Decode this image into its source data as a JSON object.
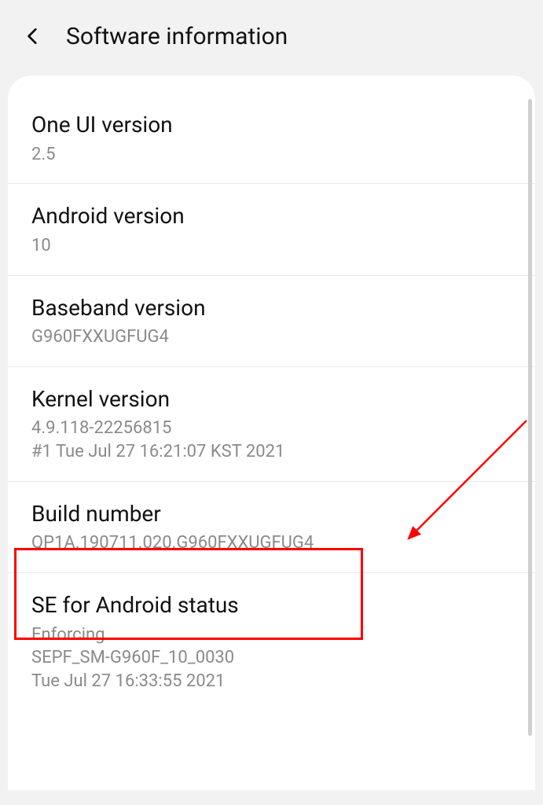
{
  "header": {
    "title": "Software information"
  },
  "items": [
    {
      "title": "One UI version",
      "value": "2.5"
    },
    {
      "title": "Android version",
      "value": "10"
    },
    {
      "title": "Baseband version",
      "value": "G960FXXUGFUG4"
    },
    {
      "title": "Kernel version",
      "value": "4.9.118-22256815\n#1 Tue Jul 27 16:21:07 KST 2021"
    },
    {
      "title": "Build number",
      "value": "QP1A.190711.020.G960FXXUGFUG4"
    },
    {
      "title": "SE for Android status",
      "value": "Enforcing\nSEPF_SM-G960F_10_0030\nTue Jul 27 16:33:55 2021"
    }
  ],
  "annotation": {
    "highlight_index": 4,
    "highlight_color": "#ff0000"
  }
}
